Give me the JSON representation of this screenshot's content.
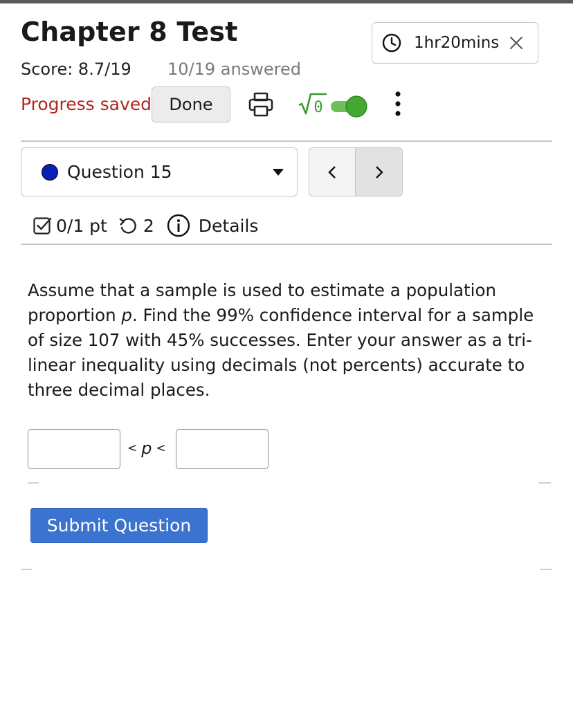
{
  "header": {
    "title": "Chapter 8 Test",
    "timer": "1hr20mins",
    "score": "Score: 8.7/19",
    "answered": "10/19 answered",
    "progress_status": "Progress saved",
    "done_label": "Done",
    "math_toggle_label": "√0",
    "math_toggle_on": true
  },
  "question_nav": {
    "selected_question": "Question 15",
    "prev_symbol": "<",
    "next_symbol": ">"
  },
  "question_meta": {
    "points": "0/1 pt",
    "retries": "2",
    "details_label": "Details"
  },
  "question": {
    "text_before": "Assume that a sample is used to estimate a population proportion ",
    "variable": "p",
    "text_after": ". Find the 99% confidence interval for a sample of size 107 with 45% successes. Enter your answer as a tri-linear inequality using decimals (not percents) accurate to three decimal places.",
    "answer_lower_value": "",
    "answer_upper_value": "",
    "lt_symbol": "<",
    "inequality_variable": "p"
  },
  "submit_label": "Submit Question",
  "colors": {
    "saved_text": "#b3261e",
    "submit_bg": "#3b73d1",
    "question_dot": "#0a1fb5",
    "toggle_on": "#43a832",
    "sqrt_green": "#3a9a2e"
  }
}
